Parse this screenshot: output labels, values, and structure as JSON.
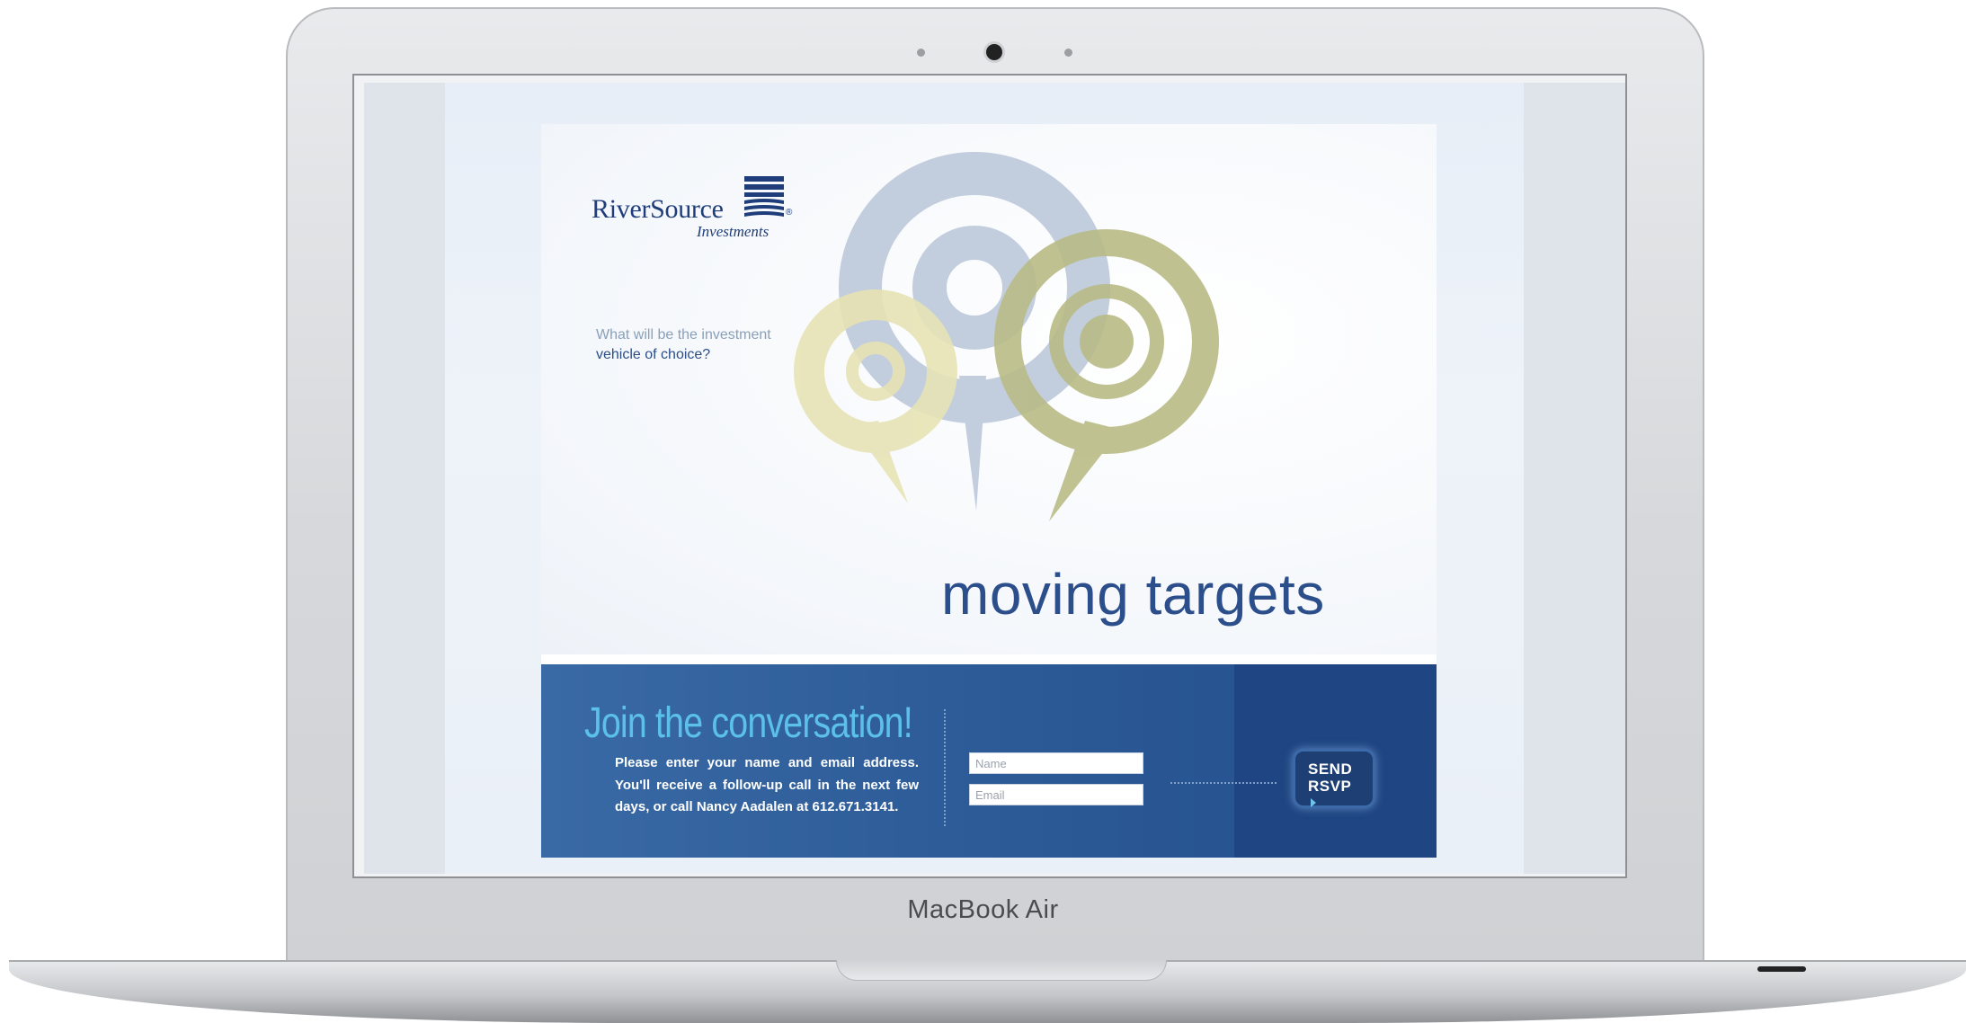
{
  "device": {
    "brand_label": "MacBook Air"
  },
  "logo": {
    "name": "RiverSource",
    "sub": "Investments",
    "reg": "®",
    "mark_icon": "riversource-stripes-logo"
  },
  "tagline": {
    "line1": "What will be the investment",
    "line2": "vehicle of choice?"
  },
  "headline": "moving targets",
  "rsvp": {
    "heading": "Join the conversation!",
    "body": "Please enter your name and email address. You'll receive a follow-up call in the next few days, or call Nancy Aadalen at 612.671.3141.",
    "name_placeholder": "Name",
    "email_placeholder": "Email",
    "send_line1": "SEND",
    "send_line2": "RSVP"
  },
  "colors": {
    "brand_navy": "#1f3d7a",
    "band_blue": "#2d5c99",
    "heading_cyan": "#5cc0ec",
    "target_gray": "#b9c6d8",
    "target_olive": "#b9bb86",
    "target_yellow": "#e7e3b5"
  }
}
